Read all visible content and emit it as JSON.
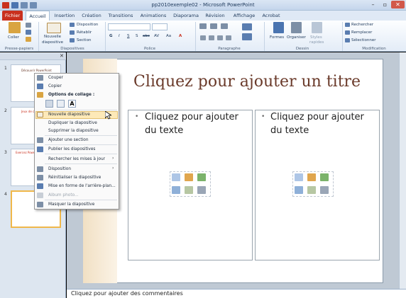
{
  "window": {
    "title": "pp2010exemple02 - Microsoft PowerPoint",
    "controls": [
      "–",
      "▫",
      "✕"
    ]
  },
  "tabs": [
    "Fichier",
    "Accueil",
    "Insertion",
    "Création",
    "Transitions",
    "Animations",
    "Diaporama",
    "Révision",
    "Affichage",
    "Acrobat"
  ],
  "ribbon": {
    "groups": [
      "Presse-papiers",
      "Diapositives",
      "Police",
      "Paragraphe",
      "Dessin",
      "Modification"
    ],
    "paste": "Coller",
    "new_slide": "Nouvelle",
    "new_slide2": "diapositive",
    "layout": "Disposition",
    "reset": "Rétablir",
    "section": "Section",
    "font_buttons": [
      "G",
      "I",
      "S",
      "S",
      "abc",
      "AV",
      "Aa",
      "A"
    ],
    "shapes": "Formes",
    "arrange": "Organiser",
    "quick_styles": "Styles",
    "quick_styles2": "rapides",
    "find": "Rechercher",
    "replace": "Remplacer",
    "select": "Sélectionner"
  },
  "colors": {
    "accent": "#c9301e",
    "slide_title": "#6a3a2a",
    "ribbon_bg": "#e3ecf7"
  },
  "thumbnails": [
    {
      "num": "1",
      "title": "Découvrir PowerPoint"
    },
    {
      "num": "2",
      "title": "Jeux de couleurs"
    },
    {
      "num": "3",
      "title": "Exercez PowerPoint"
    },
    {
      "num": "4",
      "title": ""
    }
  ],
  "slide": {
    "title_placeholder": "Cliquez pour ajouter un titre",
    "content_left": "Cliquez pour ajouter du texte",
    "content_right": "Cliquez pour ajouter du texte",
    "bullet": "•"
  },
  "notes": "Cliquez pour ajouter des commentaires",
  "context_menu": {
    "cut": "Couper",
    "copy": "Copier",
    "paste_options": "Options de collage :",
    "items": [
      "Nouvelle diapositive",
      "Dupliquer la diapositive",
      "Supprimer la diapositive",
      "Ajouter une section",
      "Publier les diapositives",
      "Rechercher les mises à jour",
      "Disposition",
      "Réinitialiser la diapositive",
      "Mise en forme de l'arrière-plan...",
      "Album photo...",
      "Masquer la diapositive"
    ],
    "submenu_arrow": "›"
  }
}
